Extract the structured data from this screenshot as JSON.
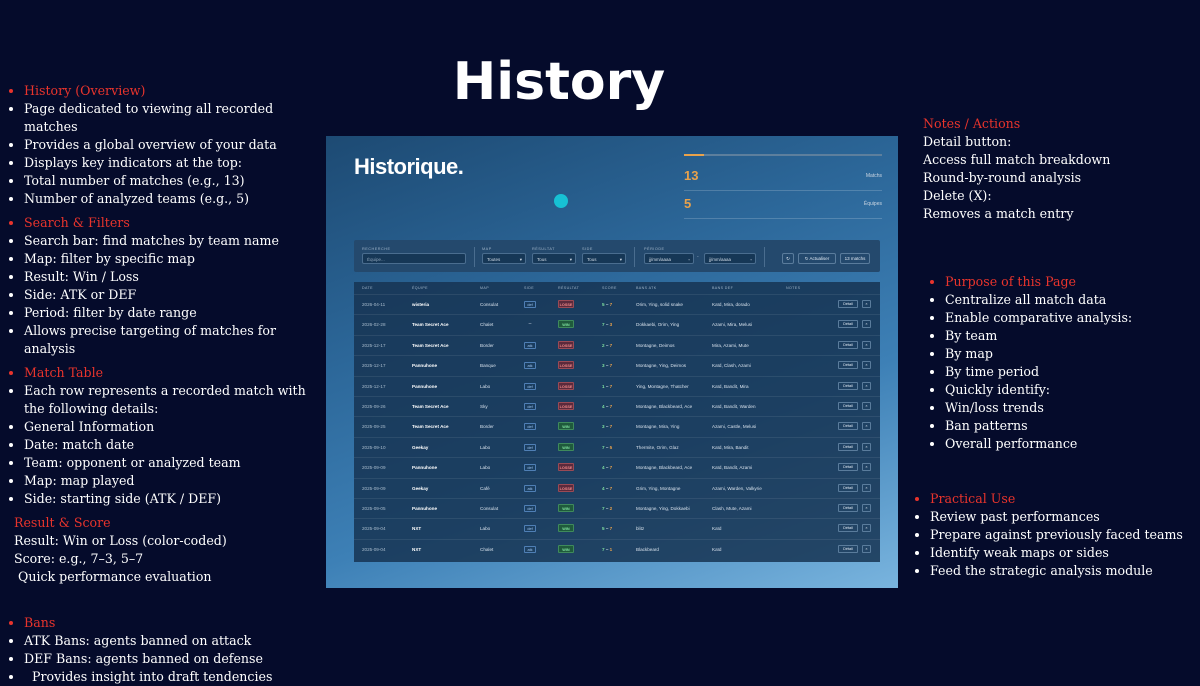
{
  "slide_title": "History",
  "left": {
    "overview": {
      "heading": "History (Overview)",
      "items": [
        "Page dedicated to viewing all recorded matches",
        "Provides a global overview of your data",
        "Displays key indicators at the top:",
        "Total number of matches (e.g., 13)",
        "Number of analyzed teams (e.g., 5)"
      ]
    },
    "filters": {
      "heading": "Search & Filters",
      "items": [
        "Search bar: find matches by team name",
        "Map: filter by specific map",
        "Result: Win / Loss",
        "Side: ATK or DEF",
        "Period: filter by date range",
        "Allows precise targeting of matches for analysis"
      ]
    },
    "table": {
      "heading": "Match Table",
      "items": [
        "Each row represents a recorded match with the following details:",
        " General Information",
        "Date: match date",
        "Team: opponent or analyzed team",
        "Map: map played",
        "Side: starting side (ATK / DEF)"
      ]
    },
    "result": {
      "heading": "Result & Score",
      "lines": [
        "Result: Win or Loss (color-coded)",
        "Score: e.g., 7–3, 5–7",
        " Quick performance evaluation"
      ]
    },
    "bans": {
      "heading": "Bans",
      "items": [
        "ATK Bans: agents banned on attack",
        "DEF Bans: agents banned on defense",
        "  Provides insight into draft tendencies"
      ]
    }
  },
  "right": {
    "notes": {
      "heading": "Notes / Actions",
      "lines": [
        "Detail button:",
        "Access full match breakdown",
        "Round-by-round analysis",
        "Delete (X):",
        "Removes a match entry"
      ]
    },
    "purpose": {
      "heading": "Purpose of this Page",
      "items": [
        "Centralize all match data",
        "Enable comparative analysis:",
        "By team",
        "By map",
        "By time period",
        "Quickly identify:",
        "Win/loss trends",
        "Ban patterns",
        "Overall performance"
      ]
    },
    "practical": {
      "heading": "Practical Use",
      "items": [
        "Review past performances",
        "Prepare against previously faced teams",
        "Identify weak maps or sides",
        "Feed the strategic analysis module"
      ]
    }
  },
  "app": {
    "title": "Historique.",
    "stats": [
      {
        "value": "13",
        "label": "Matchs"
      },
      {
        "value": "5",
        "label": "Équipes"
      }
    ],
    "filters": {
      "search_label": "RECHERCHE",
      "search_placeholder": "Équipe...",
      "map_label": "MAP",
      "map_value": "Toutes",
      "result_label": "RÉSULTAT",
      "result_value": "Tous",
      "side_label": "SIDE",
      "side_value": "Tous",
      "period_label": "PÉRIODE",
      "date_from": "jj/mm/aaaa",
      "date_to": "jj/mm/aaaa",
      "reset_icon": "↻",
      "refresh_label": "↻ Actualiser",
      "count_label": "13 matchs"
    },
    "columns": [
      "DATE",
      "ÉQUIPE",
      "MAP",
      "SIDE",
      "RÉSULTAT",
      "SCORE",
      "BANS ATK",
      "BANS DEF",
      "NOTES"
    ],
    "detail_label": "Détail",
    "delete_label": "×",
    "rows": [
      {
        "date": "2026-04-11",
        "team": "wisteria",
        "map": "Consulat",
        "side": "def",
        "result": "LOSSE",
        "s1": "5",
        "s2": "7",
        "atk": "Orim, Ying, solid snake",
        "def": "Kaïd, Mira, dorado"
      },
      {
        "date": "2026-02-28",
        "team": "Team Secret Ace",
        "map": "Chalet",
        "side": "–",
        "result": "WIN",
        "s1": "7",
        "s2": "3",
        "atk": "Dokkaebi, Orim, Ying",
        "def": "Azami, Mira, Melusi"
      },
      {
        "date": "2025-12-17",
        "team": "Team Secret Ace",
        "map": "Border",
        "side": "atk",
        "result": "LOSSE",
        "s1": "2",
        "s2": "7",
        "atk": "Montagne, Deimos",
        "def": "Mira, Azami, Mute"
      },
      {
        "date": "2025-12-17",
        "team": "Pannuhone",
        "map": "Banque",
        "side": "atk",
        "result": "LOSSE",
        "s1": "3",
        "s2": "7",
        "atk": "Montagne, Ying, Deimos",
        "def": "Kaïd, Clash, Azami"
      },
      {
        "date": "2025-12-17",
        "team": "Pannuhone",
        "map": "Labo",
        "side": "def",
        "result": "LOSSE",
        "s1": "1",
        "s2": "7",
        "atk": "Ying, Montagne, Thatcher",
        "def": "Kaïd, Bandit, Mira"
      },
      {
        "date": "2025-09-26",
        "team": "Team Secret Ace",
        "map": "Sky",
        "side": "def",
        "result": "LOSSE",
        "s1": "4",
        "s2": "7",
        "atk": "Montagne, Blackbeard, Ace",
        "def": "Kaïd, Bandit, Warden"
      },
      {
        "date": "2025-09-25",
        "team": "Team Secret Ace",
        "map": "Border",
        "side": "def",
        "result": "WIN",
        "s1": "3",
        "s2": "7",
        "atk": "Montagne, Mira, Ying",
        "def": "Azami, Castle, Melusi"
      },
      {
        "date": "2025-09-10",
        "team": "Geekay",
        "map": "Labo",
        "side": "def",
        "result": "WIN",
        "s1": "7",
        "s2": "5",
        "atk": "Thermite, Orim, Glaz",
        "def": "Kaïd, Mira, Bandit"
      },
      {
        "date": "2025-09-09",
        "team": "Pannuhone",
        "map": "Labo",
        "side": "def",
        "result": "LOSSE",
        "s1": "4",
        "s2": "7",
        "atk": "Montagne, Blackbeard, Ace",
        "def": "Kaïd, Bandit, Azami"
      },
      {
        "date": "2025-09-09",
        "team": "Geekay",
        "map": "Café",
        "side": "atk",
        "result": "LOSSE",
        "s1": "4",
        "s2": "7",
        "atk": "Grim, Ying, Montagne",
        "def": "Azami, Warden, Valkyrie"
      },
      {
        "date": "2025-09-05",
        "team": "Pannuhone",
        "map": "Consulat",
        "side": "def",
        "result": "WIN",
        "s1": "7",
        "s2": "2",
        "atk": "Montagne, Ying, Dokkaebi",
        "def": "Clash, Mute, Azami"
      },
      {
        "date": "2025-09-04",
        "team": "NXT",
        "map": "Labo",
        "side": "def",
        "result": "WIN",
        "s1": "5",
        "s2": "7",
        "atk": "blitz",
        "def": "Kaïd"
      },
      {
        "date": "2025-09-04",
        "team": "NXT",
        "map": "Chalet",
        "side": "atk",
        "result": "WIN",
        "s1": "7",
        "s2": "1",
        "atk": "Blackbeard",
        "def": "Kaïd"
      }
    ]
  }
}
